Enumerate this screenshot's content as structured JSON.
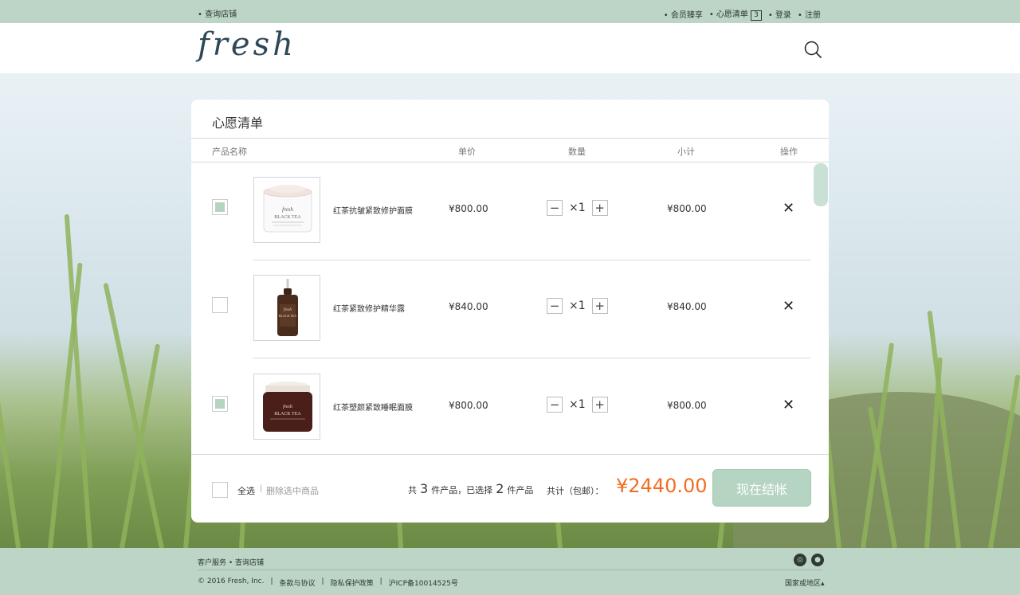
{
  "topbar": {
    "store_lookup": "查询店铺",
    "membership": "会员臻享",
    "wishlist": "心愿清单",
    "wishlist_count": "3",
    "login": "登录",
    "register": "注册"
  },
  "header": {
    "logo": "fresh",
    "search_icon": "search-icon"
  },
  "wishlist": {
    "title": "心愿清单",
    "columns": {
      "name": "产品名称",
      "unit_price": "单价",
      "quantity": "数量",
      "subtotal": "小计",
      "action": "操作"
    },
    "items": [
      {
        "name": "红茶抗皱紧致修护面膜",
        "price": "¥800.00",
        "qty": "×1",
        "subtotal": "¥800.00",
        "checked": true
      },
      {
        "name": "红茶紧致修护精华露",
        "price": "¥840.00",
        "qty": "×1",
        "subtotal": "¥840.00",
        "checked": false
      },
      {
        "name": "红茶塑颜紧致睡眠面膜",
        "price": "¥800.00",
        "qty": "×1",
        "subtotal": "¥800.00",
        "checked": true
      }
    ],
    "minus": "−",
    "plus": "+",
    "delete": "✕"
  },
  "footer_bar": {
    "select_all": "全选",
    "separator": "|",
    "delete_selected": "删除选中商品",
    "summary_prefix": "共",
    "total_count": "3",
    "summary_mid": "件产品，已选择",
    "selected_count": "2",
    "summary_suffix": "件产品",
    "total_label": "共计（包邮）：",
    "total": "¥2440.00",
    "checkout": "现在结帐"
  },
  "footer": {
    "links_top": "客户服务 • 查询店铺",
    "copyright": "© 2016 Fresh, Inc.",
    "terms": "条款与协议",
    "privacy": "隐私保护政策",
    "icp": "沪ICP备10014525号",
    "sep": "|",
    "region": "国家或地区▴",
    "icons": [
      "weibo-icon",
      "wechat-icon"
    ]
  },
  "colors": {
    "accent": "#bcd5c6",
    "button": "#b5d4c2",
    "total": "#f26d21",
    "logo": "#2f4858"
  }
}
